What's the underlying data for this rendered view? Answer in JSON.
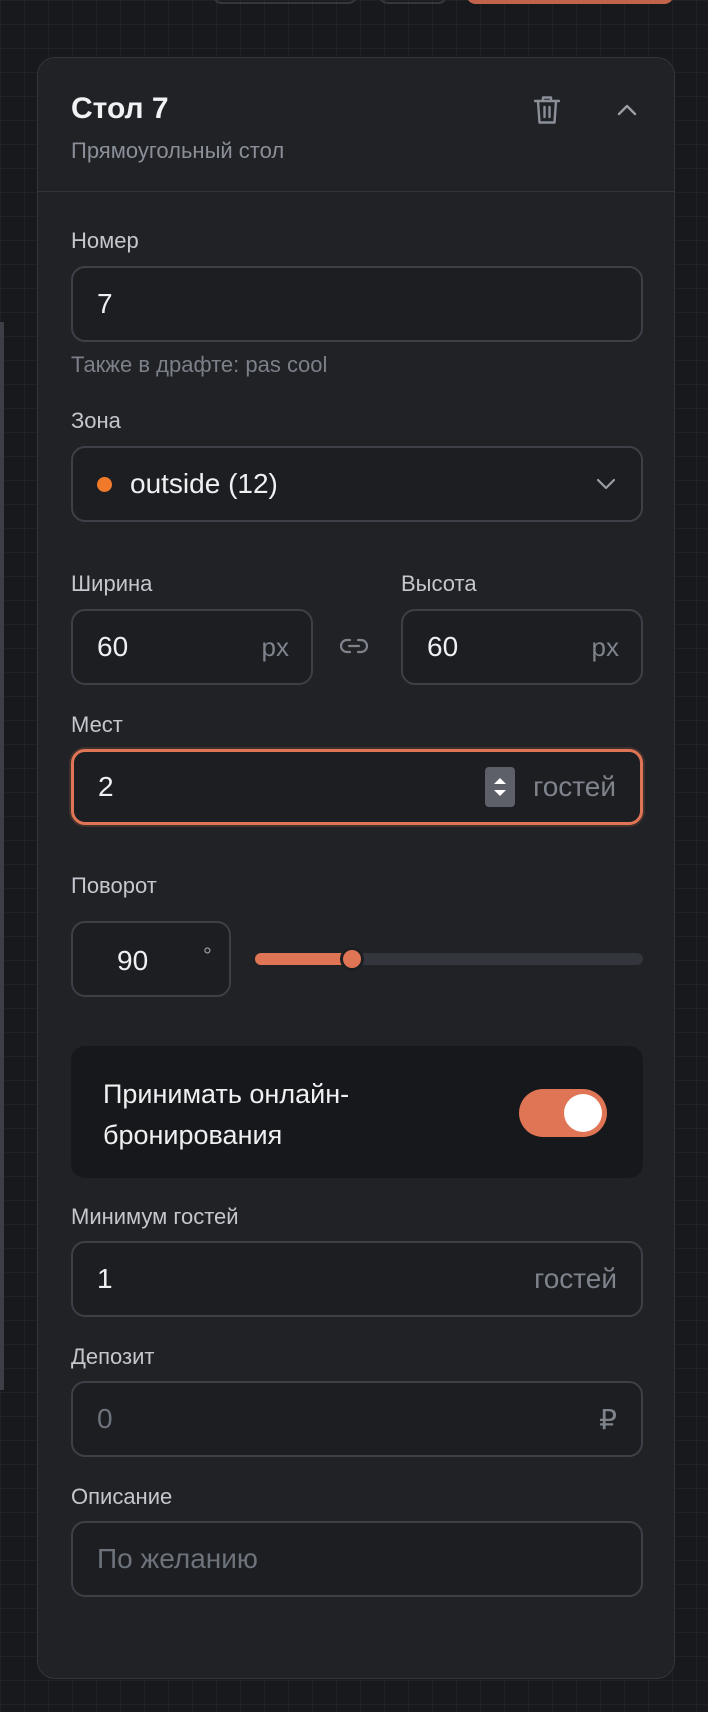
{
  "panel": {
    "title": "Стол 7",
    "subtitle": "Прямоугольный стол"
  },
  "number": {
    "label": "Номер",
    "value": "7",
    "hint": "Также в драфте: pas cool"
  },
  "zone": {
    "label": "Зона",
    "value": "outside (12)",
    "dot_color": "#f07a2a"
  },
  "width": {
    "label": "Ширина",
    "value": "60",
    "unit": "px"
  },
  "height": {
    "label": "Высота",
    "value": "60",
    "unit": "px"
  },
  "seats": {
    "label": "Мест",
    "value": "2",
    "unit": "гостей"
  },
  "rotation": {
    "label": "Поворот",
    "value": "90",
    "unit": "°",
    "slider_fraction": 0.25
  },
  "online_booking": {
    "label": "Принимать онлайн-бронирования",
    "enabled": true
  },
  "min_guests": {
    "label": "Минимум гостей",
    "value": "1",
    "unit": "гостей"
  },
  "deposit": {
    "label": "Депозит",
    "placeholder": "0",
    "unit": "₽"
  },
  "description": {
    "label": "Описание",
    "placeholder": "По желанию"
  },
  "colors": {
    "accent": "#df7554",
    "background": "#17191c",
    "panel": "#202226"
  }
}
